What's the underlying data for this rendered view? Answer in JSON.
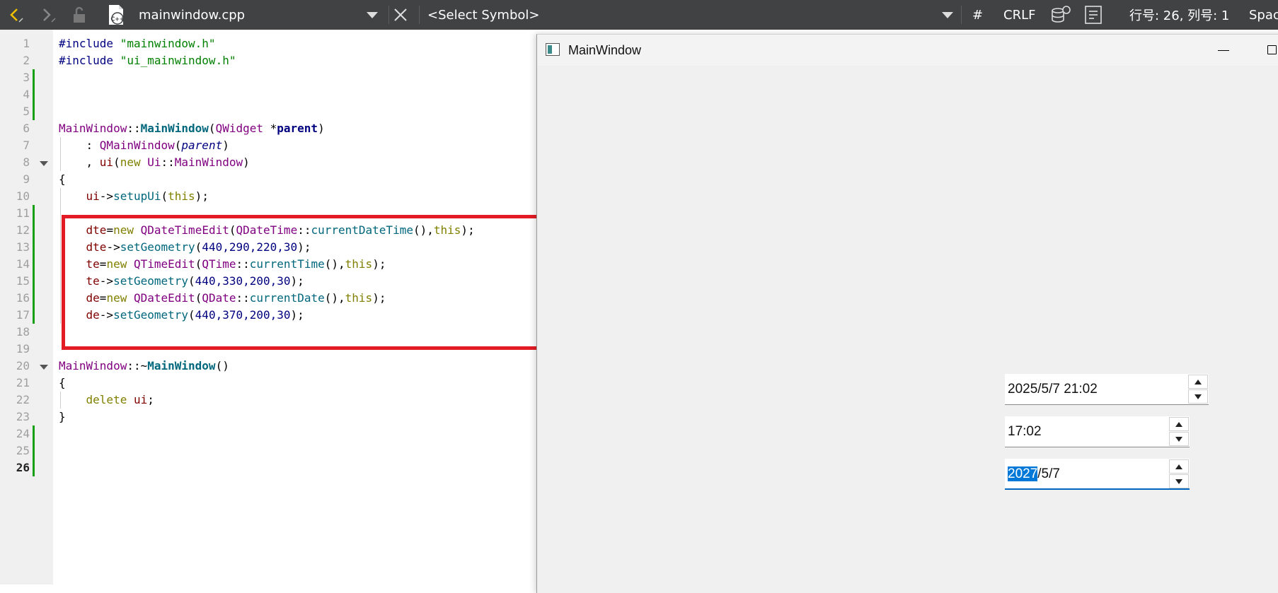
{
  "toolbar": {
    "filename": "mainwindow.cpp",
    "symbol": "<Select Symbol>",
    "hash": "#",
    "line_ending": "CRLF",
    "position": "行号: 26, 列号: 1",
    "indent": "Spac",
    "file_icon_text": "C++"
  },
  "editor": {
    "line_numbers": [
      "1",
      "2",
      "3",
      "4",
      "5",
      "6",
      "7",
      "8",
      "9",
      "10",
      "11",
      "12",
      "13",
      "14",
      "15",
      "16",
      "17",
      "18",
      "19",
      "20",
      "21",
      "22",
      "23",
      "24",
      "25",
      "26"
    ],
    "line3": "",
    "code_tokens": {
      "inc": "#include",
      "h1": "\"mainwindow.h\"",
      "h2": "\"ui_mainwindow.h\"",
      "mw": "MainWindow",
      "dcolon": "::",
      "mwf": "MainWindow",
      "lp": "(",
      "rp": ")",
      "qwidget": "QWidget",
      "star": " *",
      "parent": "parent",
      "colon_sp": "    : ",
      "qmainwindow": "QMainWindow",
      "comma_sp": "    , ",
      "ui": "ui",
      "new": "new",
      "ui_ns": "Ui",
      "lbrace": "{",
      "rbrace": "}",
      "setupUi": "setupUi",
      "this": "this",
      "arrow": "->",
      "semi": ";",
      "dte": "dte",
      "te": "te",
      "de": "de",
      "eq": "=",
      "qdatetimeedit": "QDateTimeEdit",
      "qdatetime": "QDateTime",
      "currentDateTime": "currentDateTime",
      "qtimeedit": "QTimeEdit",
      "qtime": "QTime",
      "currentTime": "currentTime",
      "qdateedit": "QDateEdit",
      "qdate": "QDate",
      "currentDate": "currentDate",
      "setGeometry": "setGeometry",
      "g1": "440,290,220,30",
      "g2": "440,330,200,30",
      "g3": "440,370,200,30",
      "n440": "440",
      "n290": "290",
      "n220": "220",
      "n330": "330",
      "n370": "370",
      "n200": "200",
      "n30": "30",
      "comma": ",",
      "tilde": "~",
      "delete": "delete",
      "indent": "    "
    }
  },
  "qt_window": {
    "title": "MainWindow",
    "datetime_value": "2025/5/7 21:02",
    "time_value": "17:02",
    "date_selected": "2027",
    "date_rest": "/5/7"
  },
  "colors": {
    "toolbar_bg": "#404244",
    "highlight_box": "#e21b24",
    "change_marker": "#16a016",
    "selection": "#0078d7"
  }
}
